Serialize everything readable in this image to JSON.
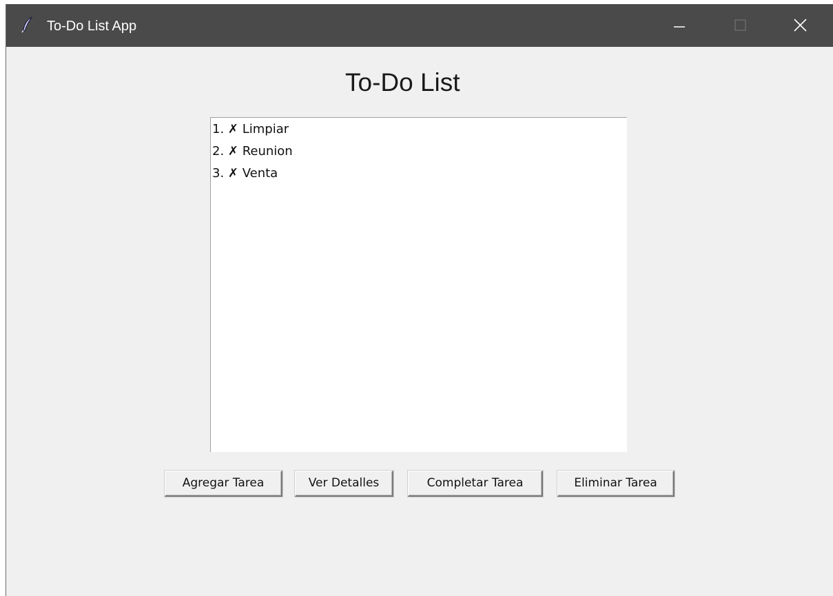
{
  "window": {
    "title": "To-Do List App",
    "app_icon": "feather-icon",
    "controls": [
      "minimize-icon",
      "maximize-icon",
      "close-icon"
    ],
    "titlebar_color": "#4a4a4a",
    "background_color": "#f0f0f0"
  },
  "main": {
    "heading": "To-Do List",
    "tasks": [
      {
        "label": "1. ✗ Limpiar"
      },
      {
        "label": "2. ✗ Reunion"
      },
      {
        "label": "3. ✗ Venta"
      }
    ],
    "buttons": {
      "add": "Agregar Tarea",
      "details": "Ver Detalles",
      "complete": "Completar Tarea",
      "delete": "Eliminar Tarea"
    }
  }
}
